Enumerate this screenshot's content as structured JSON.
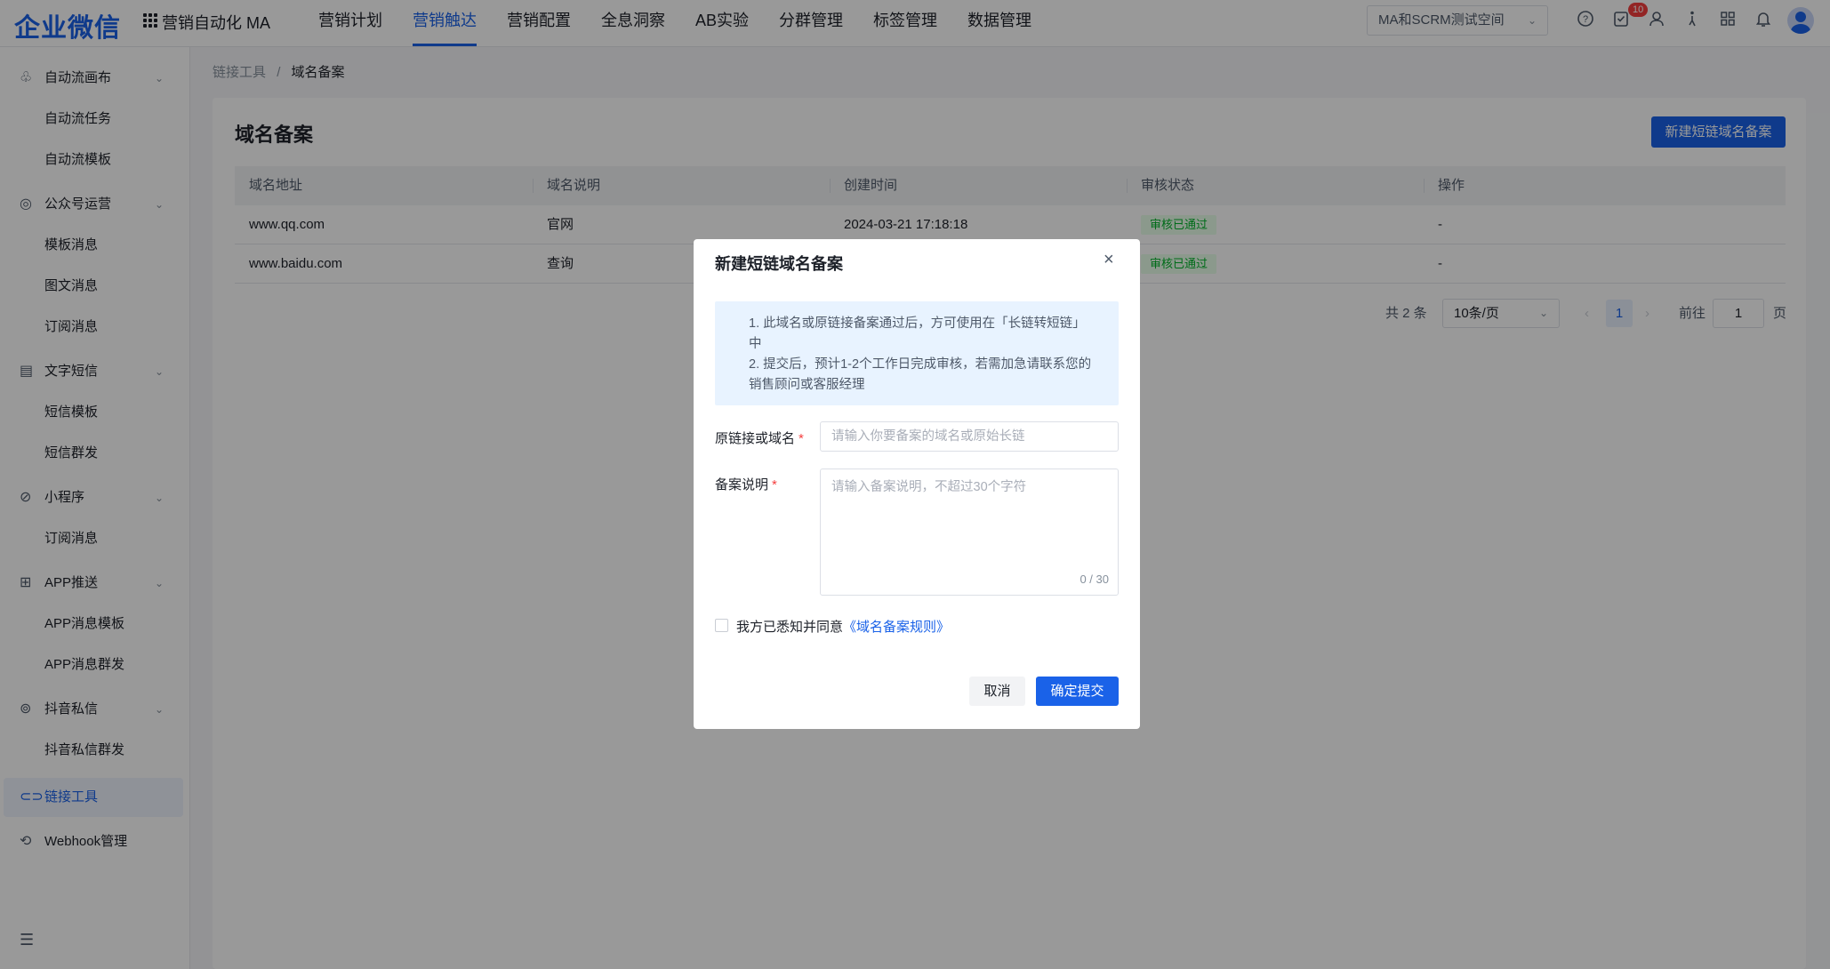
{
  "header": {
    "logo": "企业微信",
    "app_name": "营销自动化 MA",
    "nav": [
      "营销计划",
      "营销触达",
      "营销配置",
      "全息洞察",
      "AB实验",
      "分群管理",
      "标签管理",
      "数据管理"
    ],
    "active_nav": "营销触达",
    "workspace": "MA和SCRM测试空间",
    "notification_count": "10",
    "icons": [
      "help-icon",
      "task-icon",
      "user-icon",
      "accessibility-icon",
      "apps-icon",
      "bell-icon",
      "avatar"
    ]
  },
  "sidebar": {
    "groups": [
      {
        "label": "自动流画布",
        "icon": "flow-icon",
        "items": [
          "自动流任务",
          "自动流模板"
        ]
      },
      {
        "label": "公众号运营",
        "icon": "wechat-icon",
        "items": [
          "模板消息",
          "图文消息",
          "订阅消息"
        ]
      },
      {
        "label": "文字短信",
        "icon": "sms-icon",
        "items": [
          "短信模板",
          "短信群发"
        ]
      },
      {
        "label": "小程序",
        "icon": "miniprogram-icon",
        "items": [
          "订阅消息"
        ]
      },
      {
        "label": "APP推送",
        "icon": "app-icon",
        "items": [
          "APP消息模板",
          "APP消息群发"
        ]
      },
      {
        "label": "抖音私信",
        "icon": "douyin-icon",
        "items": [
          "抖音私信群发"
        ]
      }
    ],
    "link_tool": "链接工具",
    "webhook": "Webhook管理"
  },
  "breadcrumb": {
    "parent": "链接工具",
    "sep": "/",
    "current": "域名备案"
  },
  "page": {
    "title": "域名备案",
    "new_button": "新建短链域名备案",
    "columns": [
      "域名地址",
      "域名说明",
      "创建时间",
      "审核状态",
      "操作"
    ],
    "rows": [
      {
        "domain": "www.qq.com",
        "desc": "官网",
        "created": "2024-03-21 17:18:18",
        "status": "审核已通过",
        "action": "-"
      },
      {
        "domain": "www.baidu.com",
        "desc": "查询",
        "created": "",
        "status": "审核已通过",
        "action": "-"
      }
    ],
    "pagination": {
      "total": "共 2 条",
      "page_size": "10条/页",
      "current": "1",
      "goto_label": "前往",
      "goto_value": "1",
      "page_suffix": "页"
    }
  },
  "modal": {
    "title": "新建短链域名备案",
    "notice": [
      "1. 此域名或原链接备案通过后，方可使用在「长链转短链」中",
      "2. 提交后，预计1-2个工作日完成审核，若需加急请联系您的销售顾问或客服经理"
    ],
    "field1_label": "原链接或域名",
    "field1_placeholder": "请输入你要备案的域名或原始长链",
    "field2_label": "备案说明",
    "field2_placeholder": "请输入备案说明，不超过30个字符",
    "counter": "0 / 30",
    "agree_text": "我方已悉知并同意",
    "agree_link": "《域名备案规则》",
    "cancel": "取消",
    "submit": "确定提交"
  },
  "colors": {
    "accent": "#1a62e8",
    "success": "#00b42a",
    "danger": "#f53f3f"
  }
}
